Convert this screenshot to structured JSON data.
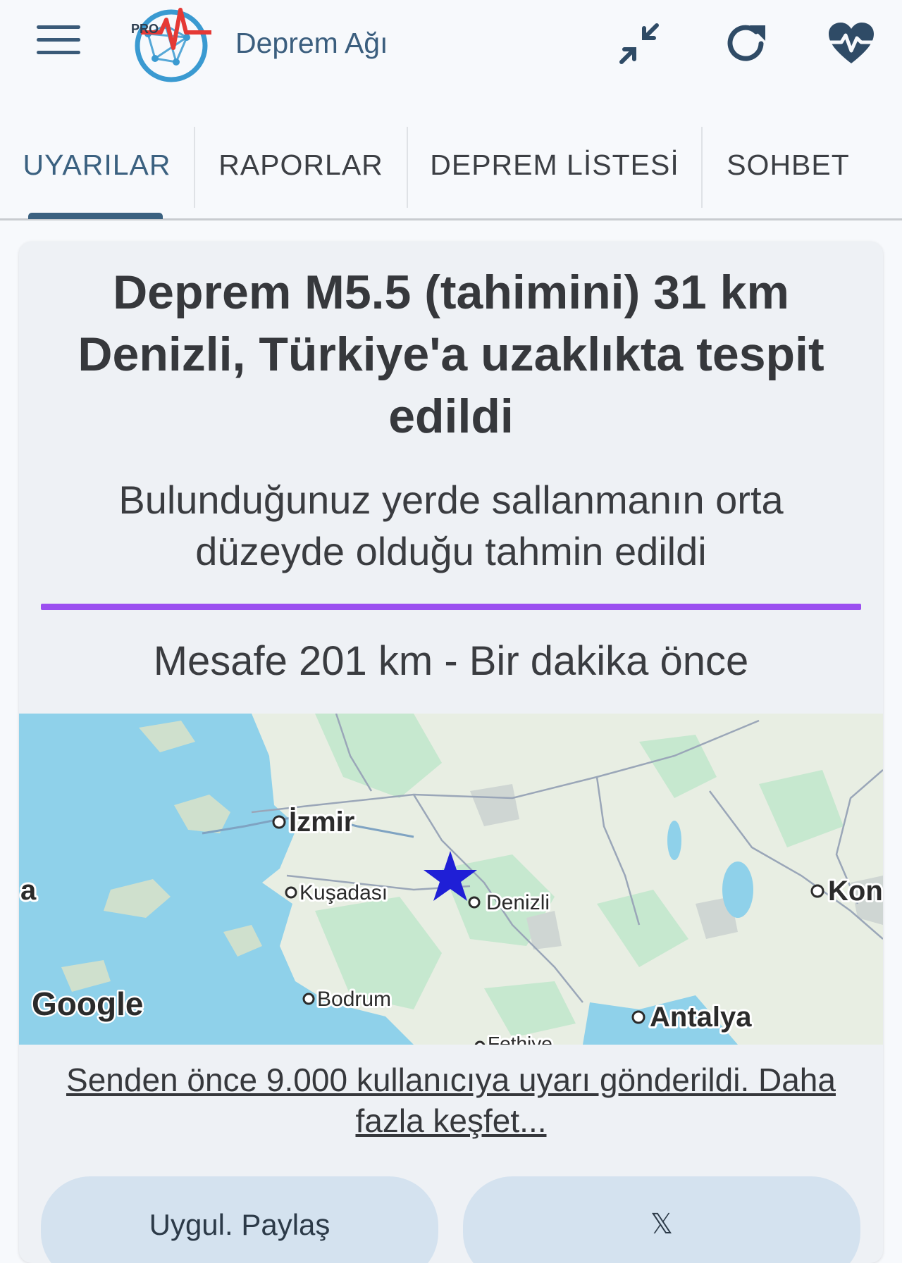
{
  "header": {
    "app_name": "Deprem Ağı",
    "logo_badge": "PRO",
    "icons": [
      "menu-icon",
      "collapse-icon",
      "refresh-icon",
      "heart-pulse-icon"
    ]
  },
  "tabs": [
    {
      "label": "UYARILAR",
      "active": true
    },
    {
      "label": "RAPORLAR",
      "active": false
    },
    {
      "label": "DEPREM LİSTESİ",
      "active": false
    },
    {
      "label": "SOHBET",
      "active": false
    }
  ],
  "alert": {
    "title": "Deprem M5.5 (tahimini) 31 km Denizli, Türkiye'a uzaklıkta tespit edildi",
    "subtitle": "Bulunduğunuz yerde sallanmanın orta düzeyde olduğu tahmin edildi",
    "intensity_color": "#9b4ff0",
    "distance_text": "Mesafe 201 km - Bir dakika önce"
  },
  "map": {
    "cities": [
      "İzmir",
      "Kuşadası",
      "Denizli",
      "Bodrum",
      "Antalya",
      "Kon",
      "a",
      "Fethiye"
    ],
    "epicenter_marker": "star-icon",
    "attribution": "Google"
  },
  "sent_info": "Senden önce 9.000 kullanıcıya uyarı gönderildi. Daha fazla keşfet...",
  "buttons": {
    "share_label": "Uygul. Paylaş",
    "x_label": "𝕏"
  },
  "colors": {
    "accent": "#3b6180",
    "intensity": "#9b4ff0",
    "sea": "#8fd1ea",
    "epicenter": "#1f1fd6"
  }
}
